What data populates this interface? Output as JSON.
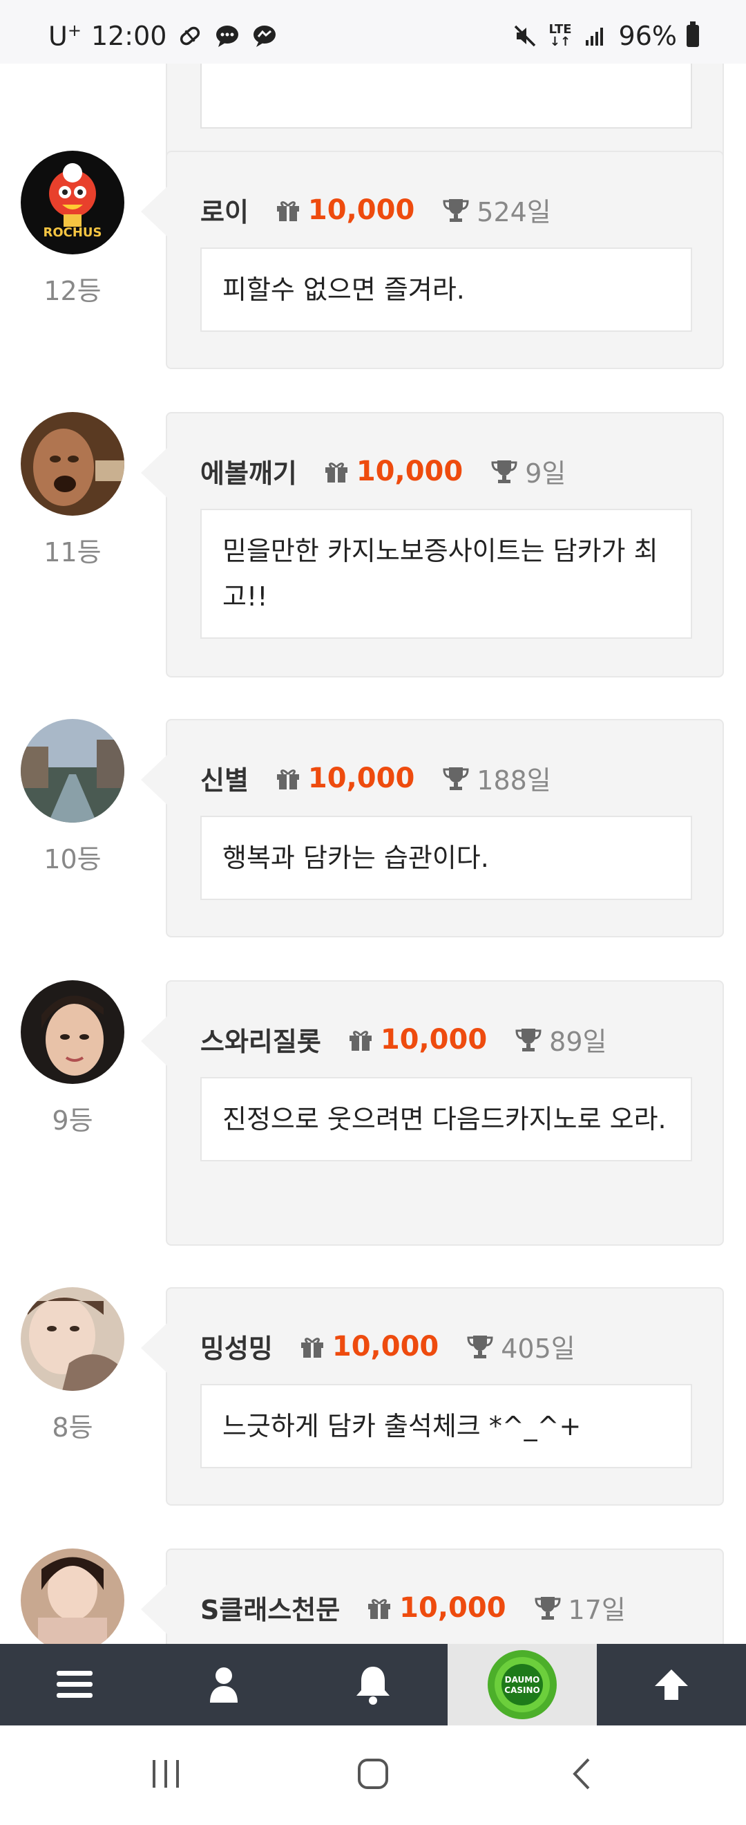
{
  "status_bar": {
    "carrier": "U",
    "carrier_sup": "+",
    "time": "12:00",
    "battery": "96%",
    "network": "LTE"
  },
  "entries": [
    {
      "name": "로이",
      "points": "10,000",
      "days": "524일",
      "rank": "12등",
      "message": "피할수 없으면 즐겨라.",
      "avatar_text": "ROCHUS"
    },
    {
      "name": "에볼깨기",
      "points": "10,000",
      "days": "9일",
      "rank": "11등",
      "message": "믿을만한 카지노보증사이트는 담카가 최고!!"
    },
    {
      "name": "신별",
      "points": "10,000",
      "days": "188일",
      "rank": "10등",
      "message": "행복과 담카는 습관이다."
    },
    {
      "name": "스와리질롯",
      "points": "10,000",
      "days": "89일",
      "rank": "9등",
      "message": "진정으로 웃으려면 다음드카지노로 오라."
    },
    {
      "name": "밍성밍",
      "points": "10,000",
      "days": "405일",
      "rank": "8등",
      "message": "느긋하게 담카 출석체크 *^_^+"
    },
    {
      "name": "S클래스천문",
      "points": "10,000",
      "days": "17일",
      "rank": "",
      "message": ""
    }
  ],
  "bottom_bar": {
    "items": [
      "menu-icon",
      "user-icon",
      "bell-icon",
      "daumo-casino-logo",
      "arrow-up-icon"
    ],
    "logo_text_1": "DAUMO",
    "logo_text_2": "CASINO"
  },
  "colors": {
    "accent": "#ee4b0e",
    "appbar": "#343a44",
    "card": "#f4f4f4"
  }
}
